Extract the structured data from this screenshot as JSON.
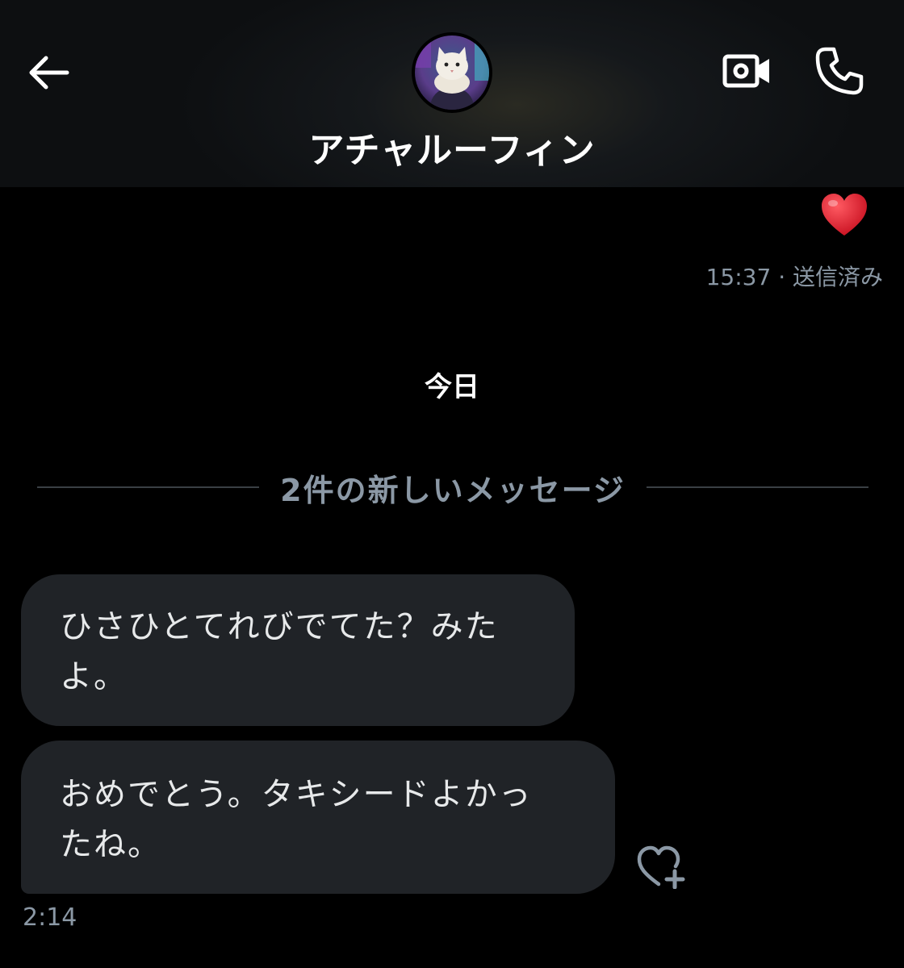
{
  "header": {
    "contact_name": "アチャルーフィン",
    "back_icon": "arrow-left-icon",
    "video_icon": "video-camera-icon",
    "phone_icon": "phone-icon"
  },
  "sent_message": {
    "content": "❤️",
    "time": "15:37",
    "status": "· 送信済み"
  },
  "day_separator": "今日",
  "new_messages_divider": "2件の新しいメッセージ",
  "received_messages": [
    {
      "text_line1": "ひさひとてれびでてた？みた",
      "text_line2": "よ。"
    },
    {
      "text_line1": "おめでとう。タキシードよかっ",
      "text_line2": "たね。"
    }
  ],
  "received_time": "2:14",
  "colors": {
    "background": "#000000",
    "bubble": "#202327",
    "secondary_text": "#8b98a5",
    "heart": "#e8202a"
  }
}
